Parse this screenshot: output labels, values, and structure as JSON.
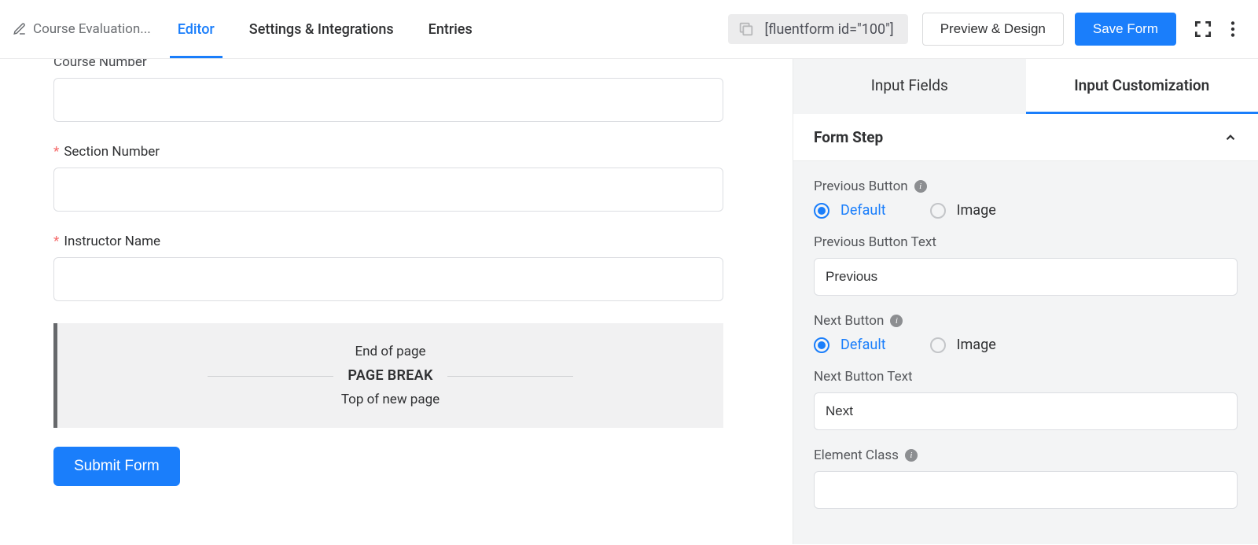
{
  "header": {
    "form_name": "Course Evaluation...",
    "tabs": {
      "editor": "Editor",
      "settings": "Settings & Integrations",
      "entries": "Entries"
    },
    "shortcode": "[fluentform id=\"100\"]",
    "preview": "Preview & Design",
    "save": "Save Form"
  },
  "canvas": {
    "fields": [
      {
        "label": "Course Number",
        "required": false,
        "cut": true
      },
      {
        "label": "Section Number",
        "required": true
      },
      {
        "label": "Instructor Name",
        "required": true
      }
    ],
    "page_break": {
      "end": "End of page",
      "label": "PAGE BREAK",
      "top": "Top of new page"
    },
    "submit": "Submit Form"
  },
  "sidebar": {
    "tabs": {
      "input_fields": "Input Fields",
      "input_custom": "Input Customization"
    },
    "panel_title": "Form Step",
    "prev_btn_label": "Previous Button",
    "prev_options": {
      "default": "Default",
      "image": "Image"
    },
    "prev_text_label": "Previous Button Text",
    "prev_text_value": "Previous",
    "next_btn_label": "Next Button",
    "next_options": {
      "default": "Default",
      "image": "Image"
    },
    "next_text_label": "Next Button Text",
    "next_text_value": "Next",
    "element_class_label": "Element Class",
    "element_class_value": ""
  }
}
